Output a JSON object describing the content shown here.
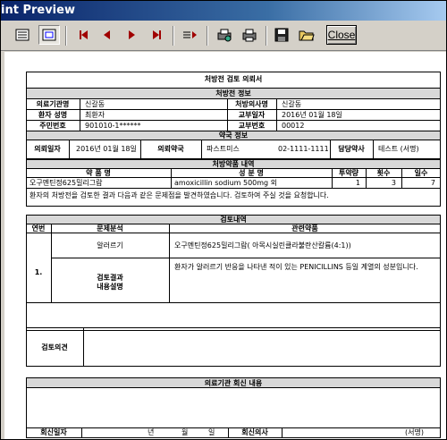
{
  "title": "int Preview",
  "toolbar": {
    "close_label": "Close",
    "icons": [
      "page-icon",
      "fit-page-icon",
      "first-page-icon",
      "prev-page-icon",
      "next-page-icon",
      "last-page-icon",
      "goto-page-icon",
      "print-setup-icon",
      "print-icon",
      "save-icon",
      "open-icon"
    ]
  },
  "report": {
    "heading": "처방전 검토 의뢰서",
    "rx_section": "처방전 정보",
    "rx": {
      "inst_label": "의료기관명",
      "inst_value": "신갈동",
      "doctor_label": "처방의사명",
      "doctor_value": "신갈동",
      "patient_label": "환자 성명",
      "patient_value": "최환자",
      "issue_date_label": "교부일자",
      "issue_date_value": "2016년 01월 18일",
      "rrn_label": "주민번호",
      "rrn_value": "901010-1******",
      "issue_no_label": "교부번호",
      "issue_no_value": "00012"
    },
    "pharmacy_section": "약국 정보",
    "pharmacy": {
      "req_date_label": "의뢰일자",
      "req_date_value": "2016년 01월 18일",
      "pharm_label": "의뢰약국",
      "pharm_value": "파스트미스",
      "phone_value": "02-1111-1111",
      "pharmacist_label": "담당약사",
      "pharmacist_value": "테스트   (서명)"
    },
    "drug_section": "처방약품 내역",
    "drug_headers": [
      "약 품 명",
      "성 분 명",
      "투약량",
      "횟수",
      "일수"
    ],
    "drugs": [
      {
        "name": "오구멘틴정625밀리그람",
        "ingredient": "amoxicillin sodium 500mg 외",
        "dose": "1",
        "times": "3",
        "days": "7"
      }
    ],
    "notice": "환자의 처방전을 검토한 결과 다음과 같은 문제점을 발견하였습니다. 검토하여 주실 것을 요청합니다.",
    "review_section": "검토내역",
    "review_headers": [
      "연번",
      "문제분석",
      "관련약품"
    ],
    "review": {
      "no": "1.",
      "problem": "알러르기",
      "related": "오구멘틴정625밀리그람( 아목시실린클라불란산칼륨(4:1))",
      "result_label": "검토결과\n내용설명",
      "result_text": "환자가 알러르기 반응을 나타낸 적이 있는 PENICILLINS 등일 계열의 성분입니다."
    },
    "opinion_label": "검토의견",
    "reply_section": "의료기관 회신 내용",
    "footer": {
      "reply_date_label": "회신일자",
      "year": "년",
      "month": "월",
      "day": "일",
      "reply_doctor_label": "회신의사",
      "sign": "(서명)"
    }
  }
}
